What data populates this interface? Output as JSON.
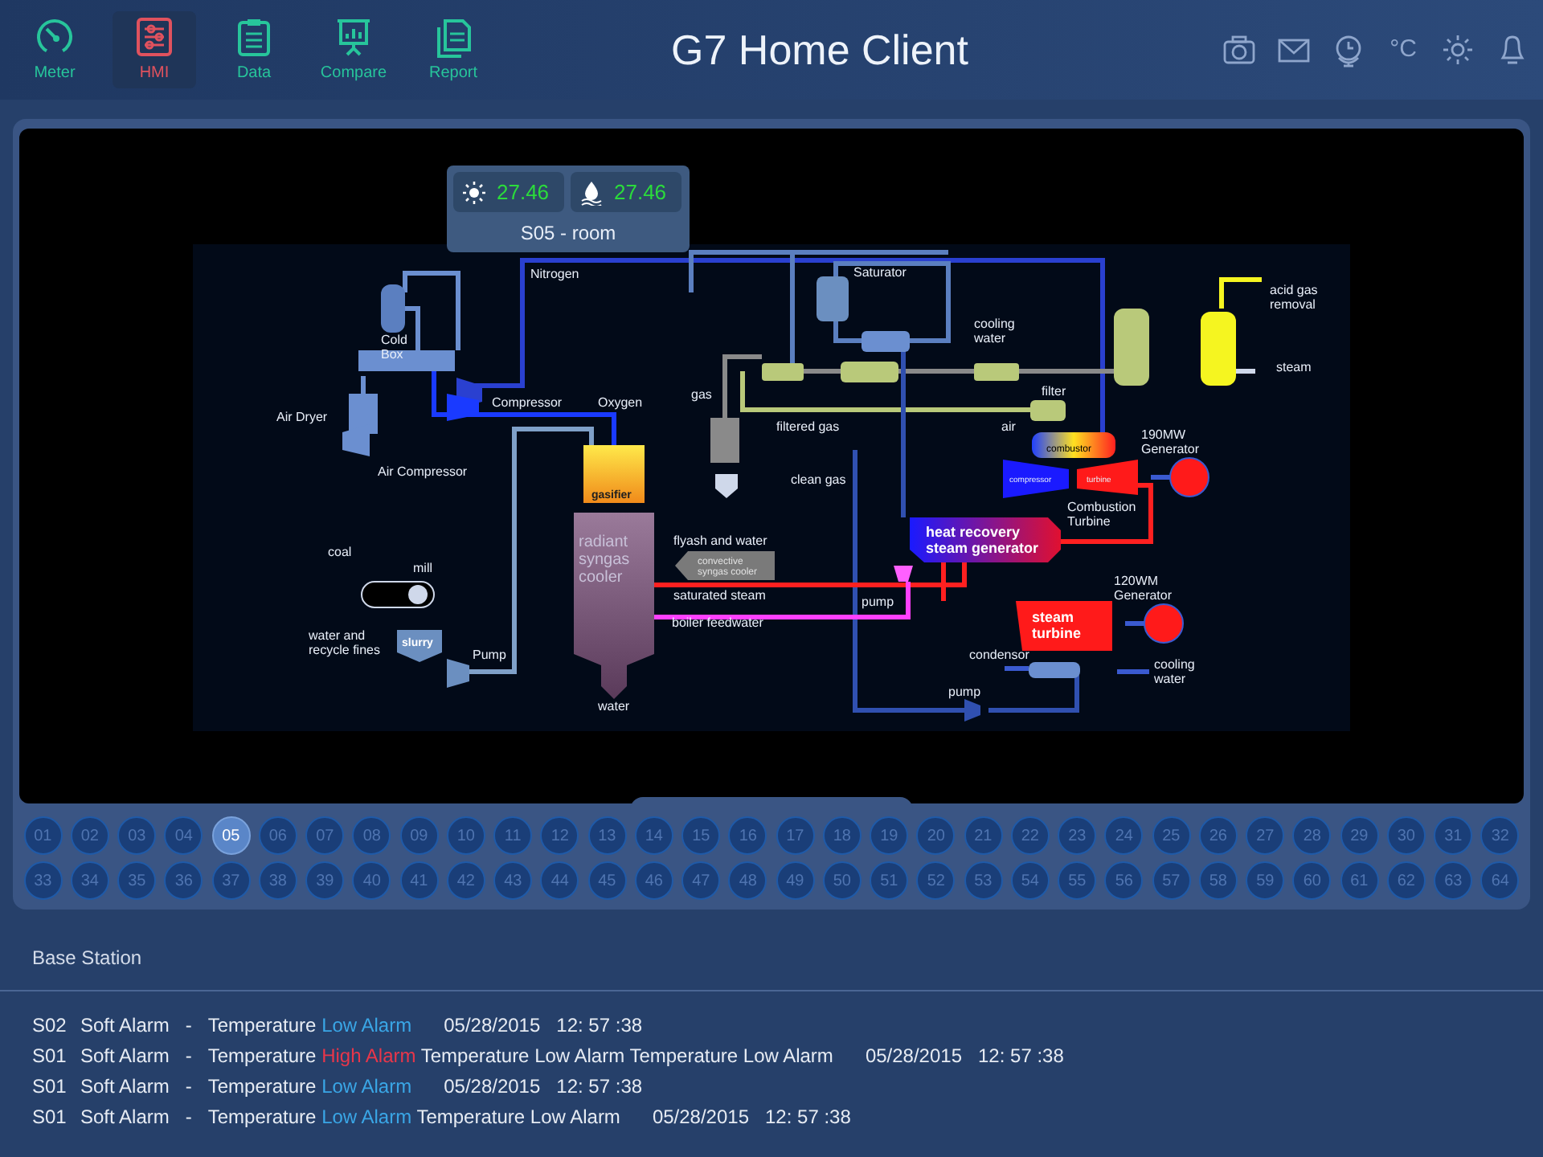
{
  "nav": [
    {
      "label": "Meter",
      "kind": "gauge",
      "selected": false
    },
    {
      "label": "HMI",
      "kind": "sliders",
      "selected": true
    },
    {
      "label": "Data",
      "kind": "clipboard",
      "selected": false
    },
    {
      "label": "Compare",
      "kind": "presentation",
      "selected": false
    },
    {
      "label": "Report",
      "kind": "documents",
      "selected": false
    }
  ],
  "title": "G7 Home Client",
  "toolbar": [
    {
      "kind": "camera"
    },
    {
      "kind": "mail"
    },
    {
      "kind": "globe-clock"
    },
    {
      "kind": "unit",
      "text": "°C"
    },
    {
      "kind": "brightness"
    },
    {
      "kind": "bell"
    }
  ],
  "popup": {
    "readings": [
      {
        "kind": "temperature",
        "value": "27.46"
      },
      {
        "kind": "humidity",
        "value": "27.46"
      }
    ],
    "label": "S05 - room"
  },
  "diagram": {
    "labels": [
      {
        "lines": [
          "Nitrogen"
        ]
      },
      {
        "lines": [
          "Saturator"
        ]
      },
      {
        "lines": [
          "acid gas",
          "removal"
        ]
      },
      {
        "lines": [
          "Cold",
          "Box"
        ]
      },
      {
        "lines": [
          "cooling",
          "water"
        ]
      },
      {
        "lines": [
          "steam"
        ]
      },
      {
        "lines": [
          "Compressor"
        ]
      },
      {
        "lines": [
          "Oxygen"
        ]
      },
      {
        "lines": [
          "gas"
        ]
      },
      {
        "lines": [
          "filter"
        ]
      },
      {
        "lines": [
          "Air Dryer"
        ]
      },
      {
        "lines": [
          "filtered gas"
        ]
      },
      {
        "lines": [
          "air"
        ]
      },
      {
        "lines": [
          "combustor"
        ]
      },
      {
        "lines": [
          "190MW",
          "Generator"
        ]
      },
      {
        "lines": [
          "Air Compressor"
        ]
      },
      {
        "lines": [
          "gasifier"
        ]
      },
      {
        "lines": [
          "clean gas"
        ]
      },
      {
        "lines": [
          "compressor"
        ]
      },
      {
        "lines": [
          "turbine"
        ]
      },
      {
        "lines": [
          "Combustion",
          "Turbine"
        ]
      },
      {
        "lines": [
          "coal"
        ]
      },
      {
        "lines": [
          "heat recovery",
          "steam generator"
        ]
      },
      {
        "lines": [
          "mill"
        ]
      },
      {
        "lines": [
          "radiant",
          "syngas",
          "cooler"
        ]
      },
      {
        "lines": [
          "flyash and water"
        ]
      },
      {
        "lines": [
          "convective",
          "syngas cooler"
        ]
      },
      {
        "lines": [
          "saturated steam"
        ]
      },
      {
        "lines": [
          "pump"
        ]
      },
      {
        "lines": [
          "120WM",
          "Generator"
        ]
      },
      {
        "lines": [
          "boiler feedwater"
        ]
      },
      {
        "lines": [
          "steam",
          "turbine"
        ]
      },
      {
        "lines": [
          "water and",
          "recycle fines"
        ]
      },
      {
        "lines": [
          "slurry"
        ]
      },
      {
        "lines": [
          "Pump"
        ]
      },
      {
        "lines": [
          "condensor"
        ]
      },
      {
        "lines": [
          "cooling",
          "water"
        ]
      },
      {
        "lines": [
          "pump"
        ]
      },
      {
        "lines": [
          "water"
        ]
      }
    ]
  },
  "stations": [
    {
      "label": "01",
      "selected": false
    },
    {
      "label": "02",
      "selected": false
    },
    {
      "label": "03",
      "selected": false
    },
    {
      "label": "04",
      "selected": false
    },
    {
      "label": "05",
      "selected": true
    },
    {
      "label": "06",
      "selected": false
    },
    {
      "label": "07",
      "selected": false
    },
    {
      "label": "08",
      "selected": false
    },
    {
      "label": "09",
      "selected": false
    },
    {
      "label": "10",
      "selected": false
    },
    {
      "label": "11",
      "selected": false
    },
    {
      "label": "12",
      "selected": false
    },
    {
      "label": "13",
      "selected": false
    },
    {
      "label": "14",
      "selected": false
    },
    {
      "label": "15",
      "selected": false
    },
    {
      "label": "16",
      "selected": false
    },
    {
      "label": "17",
      "selected": false
    },
    {
      "label": "18",
      "selected": false
    },
    {
      "label": "19",
      "selected": false
    },
    {
      "label": "20",
      "selected": false
    },
    {
      "label": "21",
      "selected": false
    },
    {
      "label": "22",
      "selected": false
    },
    {
      "label": "23",
      "selected": false
    },
    {
      "label": "24",
      "selected": false
    },
    {
      "label": "25",
      "selected": false
    },
    {
      "label": "26",
      "selected": false
    },
    {
      "label": "27",
      "selected": false
    },
    {
      "label": "28",
      "selected": false
    },
    {
      "label": "29",
      "selected": false
    },
    {
      "label": "30",
      "selected": false
    },
    {
      "label": "31",
      "selected": false
    },
    {
      "label": "32",
      "selected": false
    },
    {
      "label": "33",
      "selected": false
    },
    {
      "label": "34",
      "selected": false
    },
    {
      "label": "35",
      "selected": false
    },
    {
      "label": "36",
      "selected": false
    },
    {
      "label": "37",
      "selected": false
    },
    {
      "label": "38",
      "selected": false
    },
    {
      "label": "39",
      "selected": false
    },
    {
      "label": "40",
      "selected": false
    },
    {
      "label": "41",
      "selected": false
    },
    {
      "label": "42",
      "selected": false
    },
    {
      "label": "43",
      "selected": false
    },
    {
      "label": "44",
      "selected": false
    },
    {
      "label": "45",
      "selected": false
    },
    {
      "label": "46",
      "selected": false
    },
    {
      "label": "47",
      "selected": false
    },
    {
      "label": "48",
      "selected": false
    },
    {
      "label": "49",
      "selected": false
    },
    {
      "label": "50",
      "selected": false
    },
    {
      "label": "51",
      "selected": false
    },
    {
      "label": "52",
      "selected": false
    },
    {
      "label": "53",
      "selected": false
    },
    {
      "label": "54",
      "selected": false
    },
    {
      "label": "55",
      "selected": false
    },
    {
      "label": "56",
      "selected": false
    },
    {
      "label": "57",
      "selected": false
    },
    {
      "label": "58",
      "selected": false
    },
    {
      "label": "59",
      "selected": false
    },
    {
      "label": "60",
      "selected": false
    },
    {
      "label": "61",
      "selected": false
    },
    {
      "label": "62",
      "selected": false
    },
    {
      "label": "63",
      "selected": false
    },
    {
      "label": "64",
      "selected": false
    }
  ],
  "alarm_panel": {
    "title": "Base Station",
    "alarms": [
      {
        "station": "S02",
        "type": "Soft Alarm",
        "separator": "-",
        "parameter": "Temperature",
        "alarm": "Low Alarm",
        "color": "#3aa6e6",
        "date": "05/28/2015",
        "time": "12: 57 :38"
      },
      {
        "station": "S01",
        "type": "Soft Alarm",
        "separator": "-",
        "parameter": "Temperature",
        "alarm": "High Alarm",
        "color": "#e8364a",
        "extra": "Temperature Low Alarm Temperature Low Alarm",
        "date": "05/28/2015",
        "time": "12: 57 :38"
      },
      {
        "station": "S01",
        "type": "Soft Alarm",
        "separator": "-",
        "parameter": "Temperature",
        "alarm": "Low Alarm",
        "color": "#3aa6e6",
        "date": "05/28/2015",
        "time": "12: 57 :38"
      },
      {
        "station": "S01",
        "type": "Soft Alarm",
        "separator": "-",
        "parameter": "Temperature",
        "alarm": "Low Alarm",
        "color": "#3aa6e6",
        "extra": "Temperature Low Alarm",
        "date": "05/28/2015",
        "time": "12: 57 :38"
      }
    ]
  }
}
